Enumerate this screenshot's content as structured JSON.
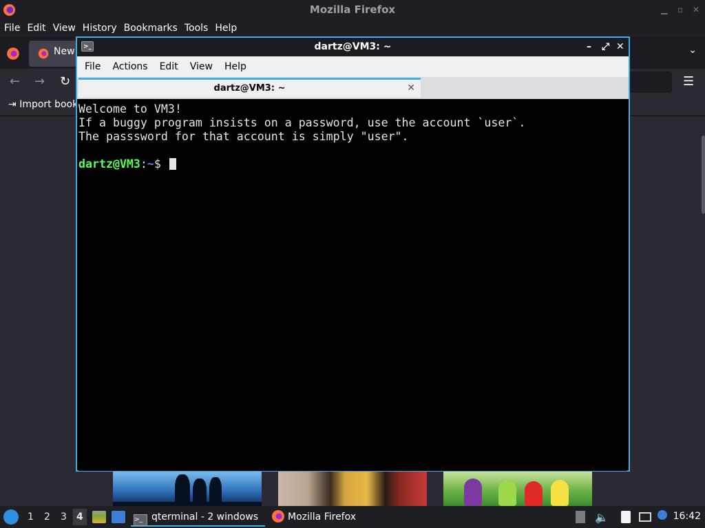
{
  "firefox": {
    "window_title": "Mozilla Firefox",
    "menu": [
      "File",
      "Edit",
      "View",
      "History",
      "Bookmarks",
      "Tools",
      "Help"
    ],
    "tab_label": "New",
    "bookmarks_label": "Import book"
  },
  "terminal": {
    "window_title": "dartz@VM3: ~",
    "menu": [
      "File",
      "Actions",
      "Edit",
      "View",
      "Help"
    ],
    "tab_title": "dartz@VM3: ~",
    "lines": [
      "Welcome to VM3!",
      "If a buggy program insists on a password, use the account `user`.",
      "The passsword for that account is simply \"user\"."
    ],
    "prompt": {
      "user_host": "dartz@VM3",
      "sep": ":",
      "path": "~",
      "symbol": "$"
    }
  },
  "panel": {
    "desktops": [
      "1",
      "2",
      "3",
      "4"
    ],
    "tasks": [
      {
        "label": "qterminal - 2 windows"
      },
      {
        "label": "Mozilla Firefox"
      }
    ],
    "clock": "16:42"
  },
  "icons": {
    "titlebar": "firefox-icon",
    "terminal": "terminal-icon",
    "start": "lxqt-start-icon"
  }
}
